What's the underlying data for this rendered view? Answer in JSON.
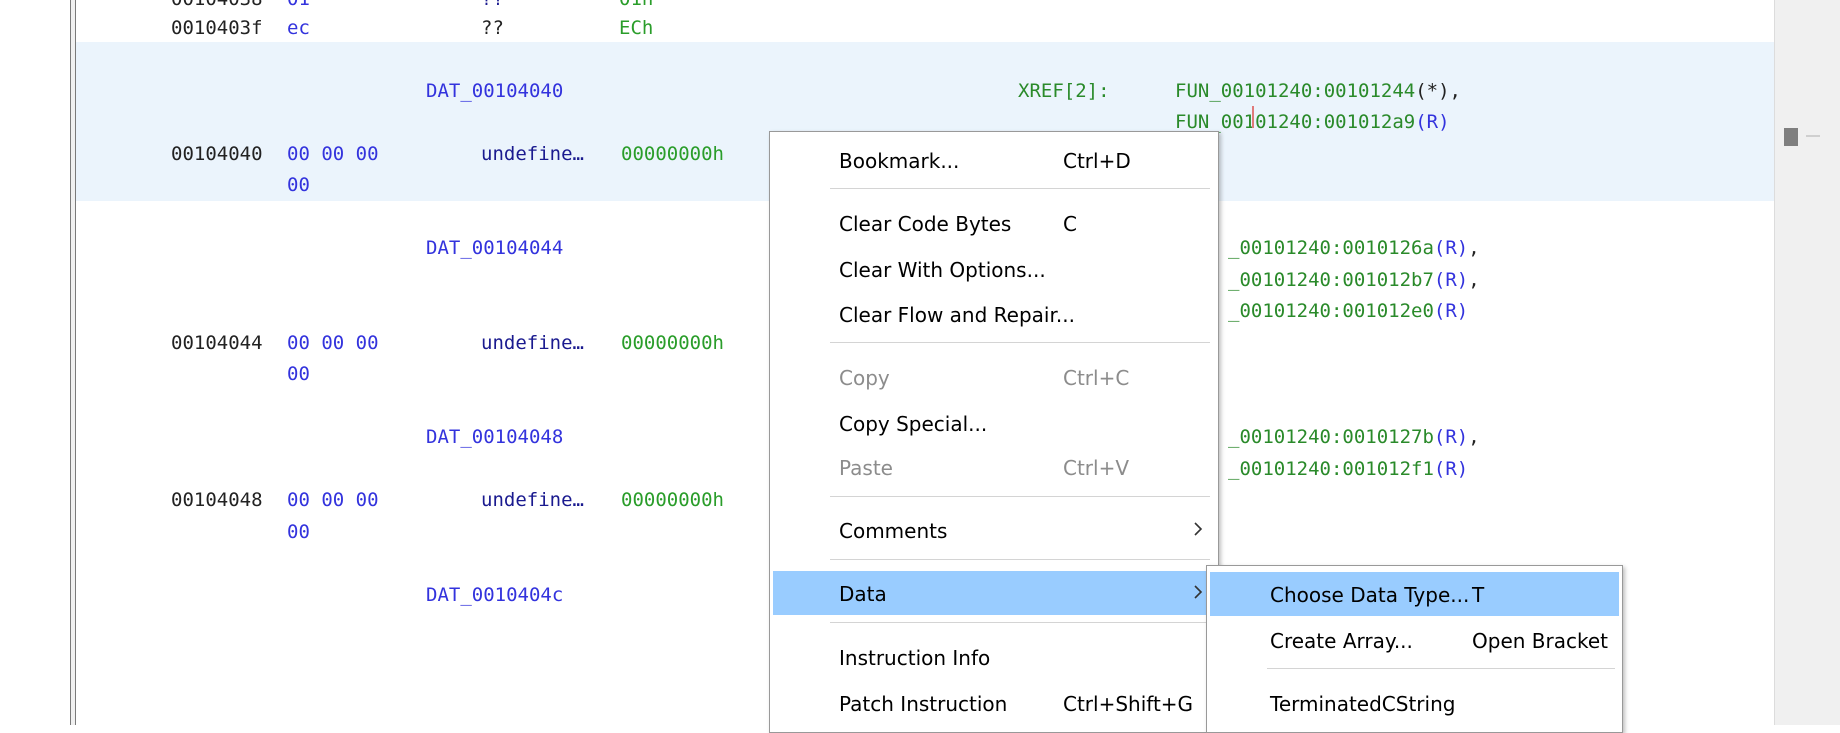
{
  "listing": {
    "rows": [
      {
        "addr": "0010403f",
        "bytes": "ec",
        "mnem": "??",
        "val": "ECh"
      },
      {
        "label": "DAT_00104040",
        "xref_label": "XREF[2]:",
        "xrefs": [
          {
            "ref": "FUN_00101240:00101244",
            "type": "(*)",
            "sep": ","
          },
          {
            "ref": "FUN_00101240:001012a9",
            "type": "(R)",
            "sep": ""
          }
        ]
      },
      {
        "addr": "00104040",
        "bytes": "00 00 00",
        "bytes2": "00",
        "mnem": "undefine…",
        "val": "00000000h"
      },
      {
        "label": "DAT_00104044",
        "xrefs": [
          {
            "ref": "_00101240:0010126a",
            "type": "(R)",
            "sep": ","
          },
          {
            "ref": "_00101240:001012b7",
            "type": "(R)",
            "sep": ","
          },
          {
            "ref": "_00101240:001012e0",
            "type": "(R)",
            "sep": ""
          }
        ]
      },
      {
        "addr": "00104044",
        "bytes": "00 00 00",
        "bytes2": "00",
        "mnem": "undefine…",
        "val": "00000000h"
      },
      {
        "label": "DAT_00104048",
        "xrefs": [
          {
            "ref": "_00101240:0010127b",
            "type": "(R)",
            "sep": ","
          },
          {
            "ref": "_00101240:001012f1",
            "type": "(R)",
            "sep": ""
          }
        ]
      },
      {
        "addr": "00104048",
        "bytes": "00 00 00",
        "bytes2": "00",
        "mnem": "undefine…",
        "val": "00000000h"
      },
      {
        "label": "DAT_0010404c"
      }
    ]
  },
  "context_menu": {
    "items": [
      {
        "label": "Bookmark...",
        "shortcut": "Ctrl+D"
      },
      {
        "label": "Clear Code Bytes",
        "shortcut": "C"
      },
      {
        "label": "Clear With Options..."
      },
      {
        "label": "Clear Flow and Repair..."
      },
      {
        "label": "Copy",
        "shortcut": "Ctrl+C",
        "disabled": true
      },
      {
        "label": "Copy Special..."
      },
      {
        "label": "Paste",
        "shortcut": "Ctrl+V",
        "disabled": true
      },
      {
        "label": "Comments",
        "submenu": true
      },
      {
        "label": "Data",
        "submenu": true,
        "selected": true
      },
      {
        "label": "Instruction Info"
      },
      {
        "label": "Patch Instruction",
        "shortcut": "Ctrl+Shift+G"
      }
    ]
  },
  "submenu": {
    "items": [
      {
        "label": "Choose Data Type...",
        "shortcut": "T",
        "selected": true
      },
      {
        "label": "Create Array...",
        "shortcut": "Open Bracket"
      },
      {
        "label": "TerminatedCString"
      }
    ]
  },
  "colors": {
    "selection": "#99ccff",
    "row_highlight": "#ebf4fc",
    "address": "#222222",
    "bytes": "#3333dd",
    "value": "#2a9d2a"
  }
}
